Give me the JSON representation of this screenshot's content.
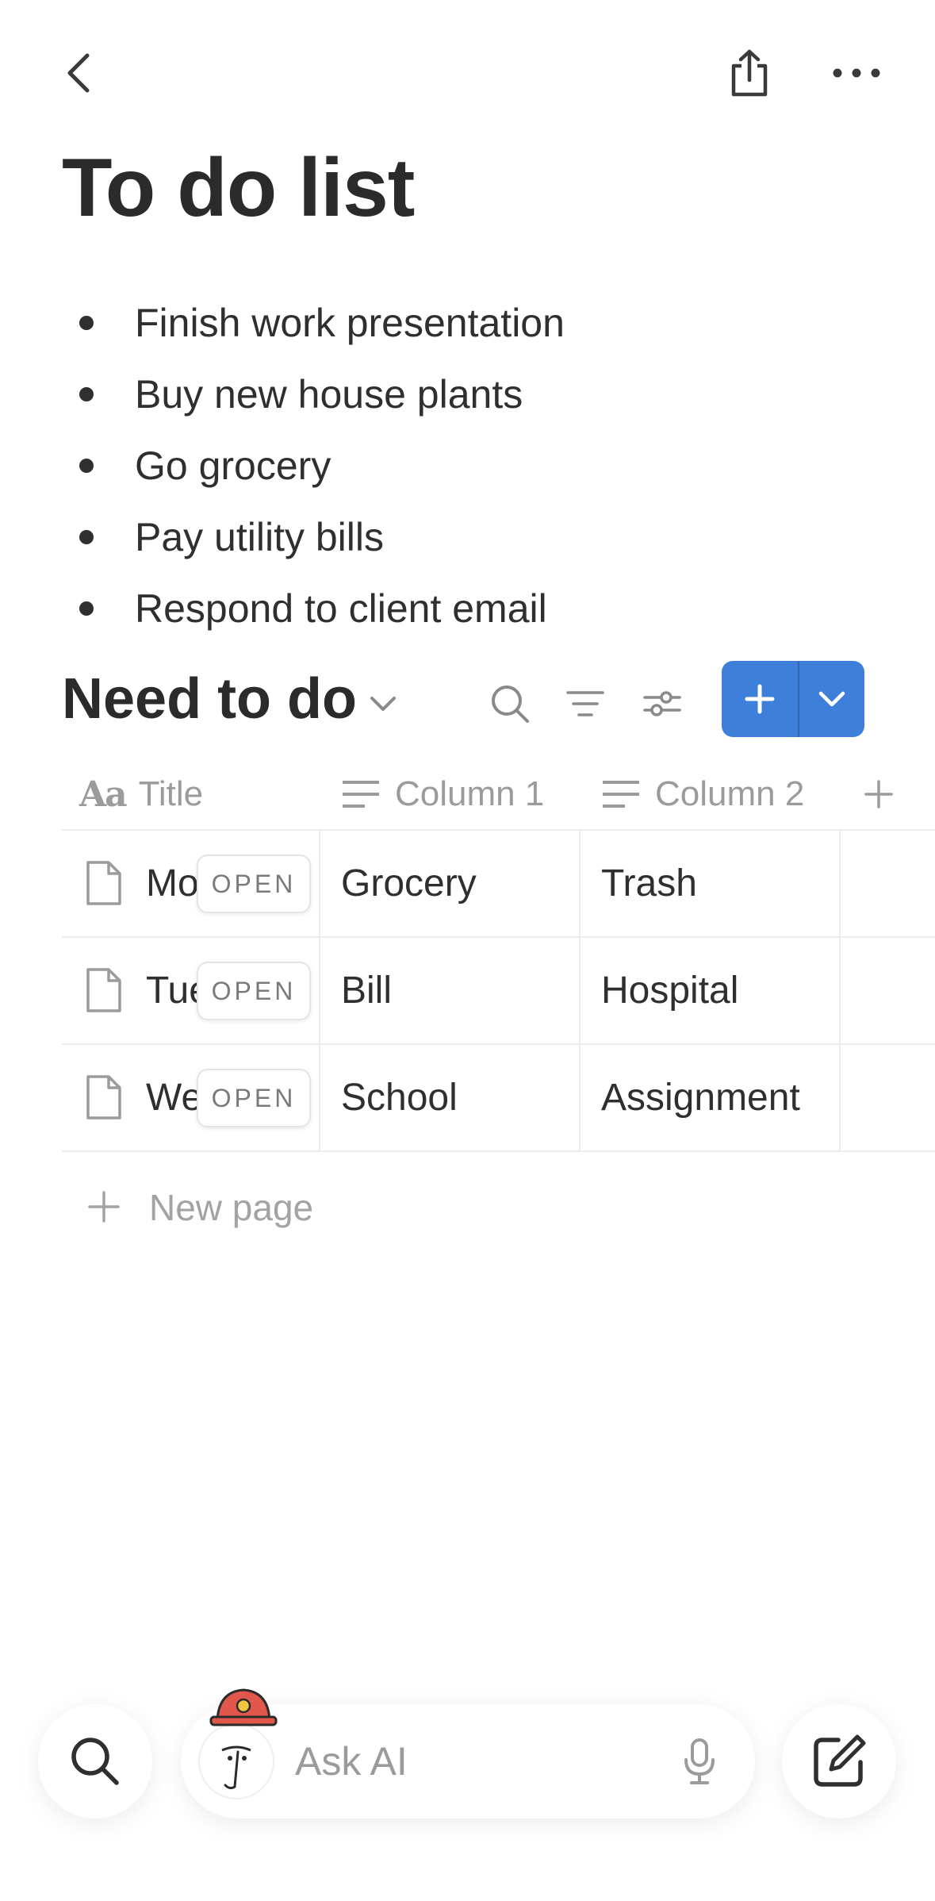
{
  "header": {
    "title": "To do list"
  },
  "bullets": [
    "Finish work presentation",
    "Buy new house plants",
    "Go grocery",
    "Pay utility bills",
    "Respond to client email"
  ],
  "database": {
    "title": "Need to do",
    "accent_color": "#3d7fd9",
    "columns": {
      "title": "Title",
      "col1": "Column 1",
      "col2": "Column 2"
    },
    "rows": [
      {
        "title": "Mo",
        "open_label": "OPEN",
        "col1": "Grocery",
        "col2": "Trash"
      },
      {
        "title": "Tue",
        "open_label": "OPEN",
        "col1": "Bill",
        "col2": "Hospital"
      },
      {
        "title": "We",
        "open_label": "OPEN",
        "col1": "School",
        "col2": "Assignment"
      }
    ],
    "new_page_label": "New page"
  },
  "bottom_bar": {
    "ask_ai_placeholder": "Ask AI"
  },
  "icons": {
    "back": "chevron-left-icon",
    "share": "share-icon",
    "more": "more-horizontal-icon",
    "search": "search-icon",
    "filter": "filter-icon",
    "settings": "sliders-icon",
    "mic": "microphone-icon",
    "compose": "compose-icon",
    "document": "document-icon"
  }
}
